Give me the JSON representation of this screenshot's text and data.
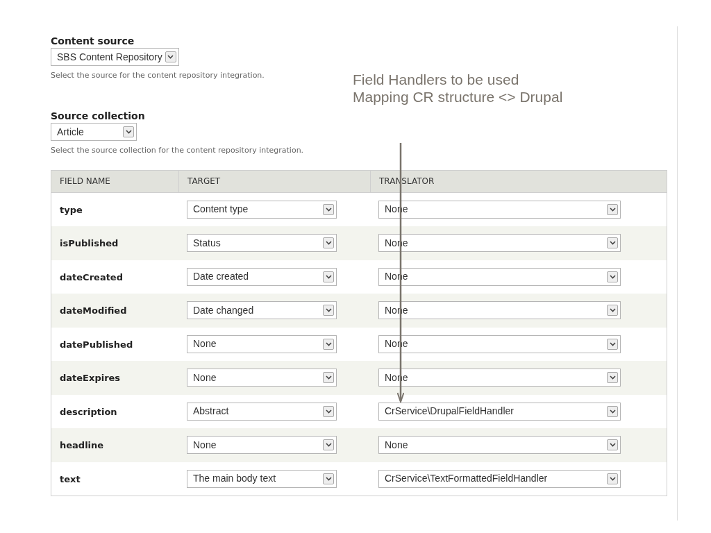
{
  "content_source": {
    "label": "Content source",
    "value": "SBS Content Repository",
    "description": "Select the source for the content repository integration."
  },
  "annotation": {
    "lines": [
      "Field Handlers to be used",
      "Mapping CR structure <> Drupal"
    ]
  },
  "source_collection": {
    "label": "Source collection",
    "value": "Article",
    "description": "Select the source collection for the content repository integration."
  },
  "table": {
    "columns": [
      "FIELD NAME",
      "TARGET",
      "TRANSLATOR"
    ],
    "rows": [
      {
        "field": "type",
        "target": "Content type",
        "translator": "None"
      },
      {
        "field": "isPublished",
        "target": "Status",
        "translator": "None"
      },
      {
        "field": "dateCreated",
        "target": "Date created",
        "translator": "None"
      },
      {
        "field": "dateModified",
        "target": "Date changed",
        "translator": "None"
      },
      {
        "field": "datePublished",
        "target": "None",
        "translator": "None"
      },
      {
        "field": "dateExpires",
        "target": "None",
        "translator": "None"
      },
      {
        "field": "description",
        "target": "Abstract",
        "translator": "CrService\\DrupalFieldHandler"
      },
      {
        "field": "headline",
        "target": "None",
        "translator": "None"
      },
      {
        "field": "text",
        "target": "The main body text",
        "translator": "CrService\\TextFormattedFieldHandler"
      }
    ]
  }
}
